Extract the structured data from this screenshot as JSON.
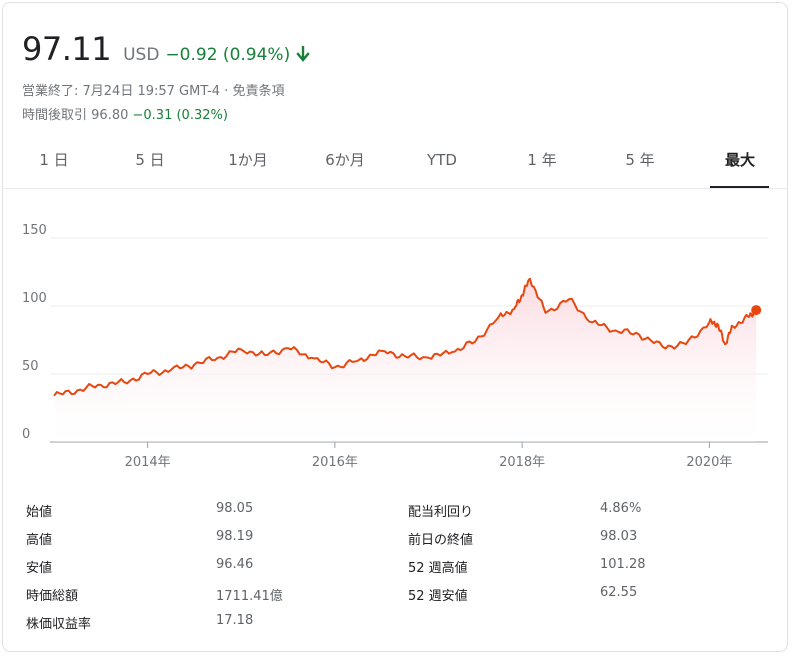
{
  "quote": {
    "price": "97.11",
    "currency": "USD",
    "change": "−0.92 (0.94%)",
    "direction": "down",
    "status": "営業終了: 7月24日 19:57 GMT-4 · 免責条項",
    "after_hours_label": "時間後取引",
    "after_hours_price": "96.80",
    "after_hours_change": "−0.31 (0.32%)"
  },
  "tabs": [
    "1 日",
    "5 日",
    "1か月",
    "6か月",
    "YTD",
    "1 年",
    "5 年",
    "最大"
  ],
  "active_tab": "最大",
  "colors": {
    "line": "#e8470f",
    "positive": "#188038",
    "fill": "#fde6ea"
  },
  "chart_data": {
    "type": "area",
    "x_tick_labels": [
      "2014年",
      "2016年",
      "2018年",
      "2020年"
    ],
    "y_tick_labels": [
      "0",
      "50",
      "100",
      "150"
    ],
    "ylim": [
      0,
      150
    ],
    "xlim": [
      "2013-01",
      "2020-08"
    ],
    "grid": true,
    "x": [
      "2013-01",
      "2013-04",
      "2013-07",
      "2013-10",
      "2014-01",
      "2014-04",
      "2014-07",
      "2014-10",
      "2015-01",
      "2015-04",
      "2015-07",
      "2015-10",
      "2016-01",
      "2016-04",
      "2016-07",
      "2016-10",
      "2017-01",
      "2017-04",
      "2017-07",
      "2017-10",
      "2017-12",
      "2018-01",
      "2018-02",
      "2018-04",
      "2018-07",
      "2018-10",
      "2019-01",
      "2019-04",
      "2019-07",
      "2019-10",
      "2020-01",
      "2020-02",
      "2020-03",
      "2020-04",
      "2020-06",
      "2020-07"
    ],
    "values": [
      34,
      38,
      42,
      44,
      50,
      53,
      57,
      62,
      68,
      64,
      69,
      62,
      55,
      60,
      67,
      63,
      62,
      66,
      74,
      92,
      98,
      108,
      120,
      95,
      105,
      88,
      82,
      79,
      70,
      72,
      88,
      87,
      72,
      85,
      92,
      97
    ]
  },
  "stats": {
    "left": [
      {
        "label": "始値",
        "value": "98.05"
      },
      {
        "label": "高値",
        "value": "98.19"
      },
      {
        "label": "安値",
        "value": "96.46"
      },
      {
        "label": "時価総額",
        "value": "1711.41億"
      },
      {
        "label": "株価収益率",
        "value": "17.18"
      }
    ],
    "right": [
      {
        "label": "配当利回り",
        "value": "4.86%"
      },
      {
        "label": "前日の終値",
        "value": "98.03"
      },
      {
        "label": "52 週高値",
        "value": "101.28"
      },
      {
        "label": "52 週安値",
        "value": "62.55"
      }
    ]
  }
}
